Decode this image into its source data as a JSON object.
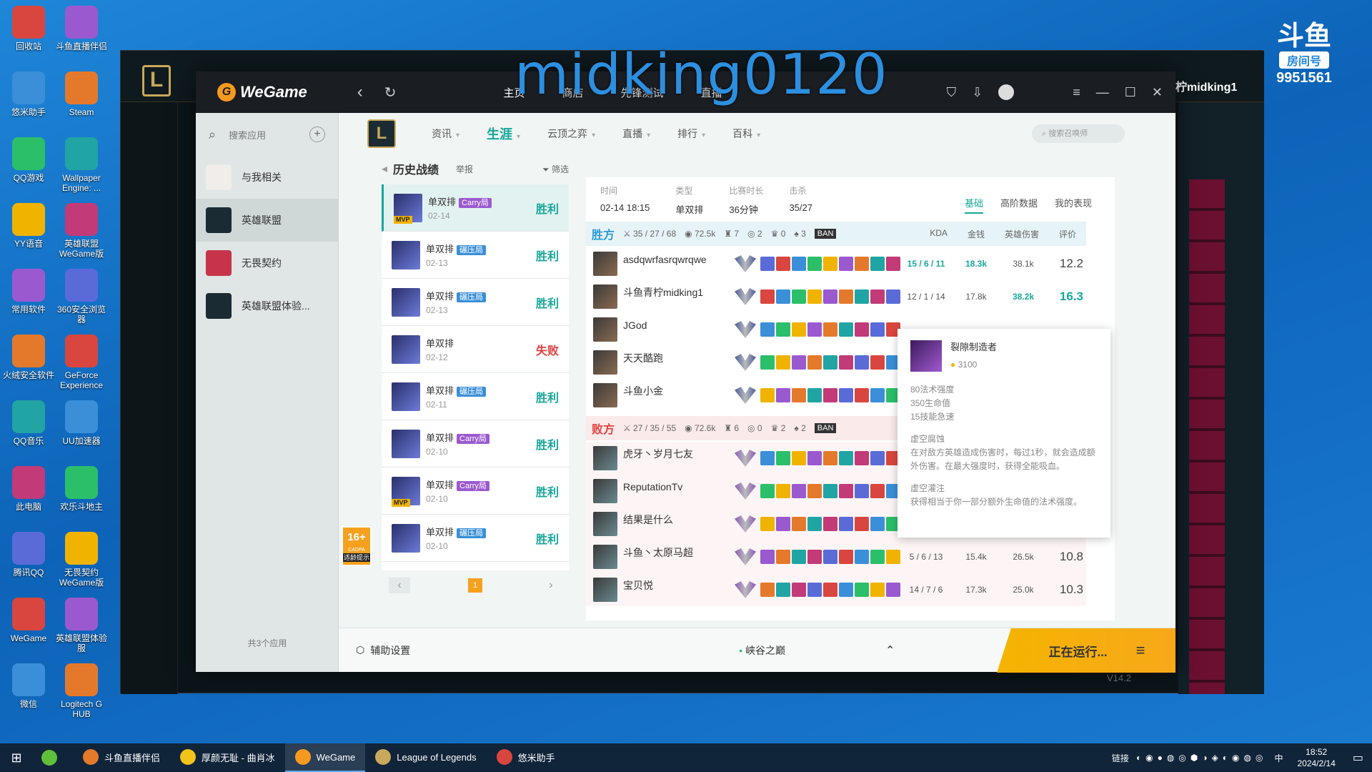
{
  "desktop": {
    "icons_col1": [
      "回收站",
      "悠米助手",
      "QQ游戏",
      "YY语音",
      "常用软件",
      "火绒安全软件",
      "QQ音乐",
      "此电脑",
      "腾讯QQ",
      "WeGame",
      "微信"
    ],
    "icons_col2": [
      "斗鱼直播伴侣",
      "Steam",
      "Wallpaper Engine: ...",
      "英雄联盟WeGame版",
      "360安全浏览器",
      "GeForce Experience",
      "UU加速器",
      "欢乐斗地主",
      "无畏契约WeGame版",
      "英雄联盟体验服",
      "Logitech G HUB"
    ]
  },
  "overlay": {
    "streamer_text": "midking0120",
    "room_label": "房间号",
    "room_number": "9951561",
    "user": "柠midking1"
  },
  "wegame": {
    "brand": "WeGame",
    "top_nav": [
      "主页",
      "商店",
      "先锋测试",
      "直播"
    ],
    "sidebar": {
      "search_placeholder": "搜索应用",
      "items": [
        "与我相关",
        "英雄联盟",
        "无畏契约",
        "英雄联盟体验..."
      ],
      "footer": "共3个应用"
    },
    "game_nav": [
      {
        "label": "资讯"
      },
      {
        "label": "生涯"
      },
      {
        "label": "云顶之弈"
      },
      {
        "label": "直播"
      },
      {
        "label": "排行"
      },
      {
        "label": "百科"
      }
    ],
    "summoner_search_placeholder": "搜索召唤师",
    "history": {
      "title": "历史战绩",
      "report": "举报",
      "filter": "筛选",
      "matches": [
        {
          "type": "单双排",
          "tag": "Carry局",
          "tag_color": "#9b59d0",
          "date": "02-14",
          "result": "胜利",
          "mvp": true,
          "win": true
        },
        {
          "type": "单双排",
          "tag": "碾压局",
          "tag_color": "#3a8fd8",
          "date": "02-13",
          "result": "胜利",
          "mvp": false,
          "win": true
        },
        {
          "type": "单双排",
          "tag": "碾压局",
          "tag_color": "#3a8fd8",
          "date": "02-13",
          "result": "胜利",
          "mvp": false,
          "win": true
        },
        {
          "type": "单双排",
          "tag": "",
          "tag_color": "",
          "date": "02-12",
          "result": "失败",
          "mvp": false,
          "win": false
        },
        {
          "type": "单双排",
          "tag": "碾压局",
          "tag_color": "#3a8fd8",
          "date": "02-11",
          "result": "胜利",
          "mvp": false,
          "win": true
        },
        {
          "type": "单双排",
          "tag": "Carry局",
          "tag_color": "#9b59d0",
          "date": "02-10",
          "result": "胜利",
          "mvp": false,
          "win": true
        },
        {
          "type": "单双排",
          "tag": "Carry局",
          "tag_color": "#9b59d0",
          "date": "02-10",
          "result": "胜利",
          "mvp": true,
          "win": true
        },
        {
          "type": "单双排",
          "tag": "碾压局",
          "tag_color": "#3a8fd8",
          "date": "02-10",
          "result": "胜利",
          "mvp": false,
          "win": true
        }
      ],
      "page": "1"
    },
    "age_badge": {
      "num": "16+",
      "label": "适龄提示",
      "sub": "CADPA"
    },
    "detail": {
      "info_labels": [
        "时间",
        "类型",
        "比赛时长",
        "击杀"
      ],
      "info_values": [
        "02-14 18:15",
        "单双排",
        "36分钟",
        "35/27"
      ],
      "tabs": [
        "基础",
        "高阶数据",
        "我的表现"
      ],
      "win_team": {
        "label": "胜方",
        "kda": "35 / 27 / 68",
        "gold": "72.5k",
        "towers": "7",
        "dragons": "2",
        "barons": "0",
        "heralds": "3",
        "ban": "BAN"
      },
      "lose_team": {
        "label": "败方",
        "kda": "27 / 35 / 55",
        "gold": "72.6k",
        "towers": "6",
        "dragons": "0",
        "barons": "2",
        "heralds": "2",
        "ban": "BAN"
      },
      "columns": [
        "KDA",
        "金钱",
        "英雄伤害",
        "评价"
      ],
      "winners": [
        {
          "name": "asdqwrfasrqwrqwe",
          "kda": "15 / 6 / 11",
          "gold": "18.3k",
          "dmg": "38.1k",
          "score": "12.2",
          "kda_hl": true,
          "gold_hl": true,
          "dmg_hl": false,
          "score_hl": false
        },
        {
          "name": "斗鱼青柠midking1",
          "kda": "12 / 1 / 14",
          "gold": "17.8k",
          "dmg": "38.2k",
          "score": "16.3",
          "kda_hl": false,
          "gold_hl": false,
          "dmg_hl": true,
          "score_hl": true
        },
        {
          "name": "JGod",
          "kda": "",
          "gold": "",
          "dmg": "",
          "score": "",
          "kda_hl": false,
          "gold_hl": false,
          "dmg_hl": false,
          "score_hl": false
        },
        {
          "name": "天天酷跑",
          "kda": "",
          "gold": "",
          "dmg": "",
          "score": "",
          "kda_hl": false,
          "gold_hl": false,
          "dmg_hl": false,
          "score_hl": false
        },
        {
          "name": "斗鱼小金",
          "kda": "",
          "gold": "",
          "dmg": "",
          "score": "",
          "kda_hl": false,
          "gold_hl": false,
          "dmg_hl": false,
          "score_hl": false
        }
      ],
      "losers": [
        {
          "name": "虎牙丶岁月七友",
          "kda": "",
          "gold": "",
          "dmg": "",
          "score": ""
        },
        {
          "name": "ReputationTv",
          "kda": "",
          "gold": "",
          "dmg": "",
          "score": ""
        },
        {
          "name": "结果是什么",
          "kda": "",
          "gold": "",
          "dmg": "",
          "score": ""
        },
        {
          "name": "斗鱼丶太原马超",
          "kda": "5 / 6 / 13",
          "gold": "15.4k",
          "dmg": "26.5k",
          "score": "10.8"
        },
        {
          "name": "宝贝悦",
          "kda": "14 / 7 / 6",
          "gold": "17.3k",
          "dmg": "25.0k",
          "score": "10.3"
        }
      ]
    },
    "tooltip": {
      "title": "裂隙制造者",
      "cost": "3100",
      "stats": [
        "80法术强度",
        "350生命值",
        "15技能急速"
      ],
      "passive1_title": "虚空腐蚀",
      "passive1_text": "在对敌方英雄造成伤害时，每过1秒，就会造成额外伤害。在最大强度时，获得全能吸血。",
      "passive2_title": "虚空灌注",
      "passive2_text": "获得相当于你一部分额外生命值的法术强度。"
    },
    "bottom": {
      "assist": "辅助设置",
      "server": "峡谷之巅",
      "running": "正在运行..."
    }
  },
  "taskbar": {
    "apps": [
      "斗鱼直播伴侣",
      "厚颜无耻 - 曲肖冰",
      "WeGame",
      "League of Legends",
      "悠米助手"
    ],
    "active_index": 2,
    "tray_label": "链接",
    "ime": "中",
    "time": "18:52",
    "date": "2024/2/14"
  }
}
